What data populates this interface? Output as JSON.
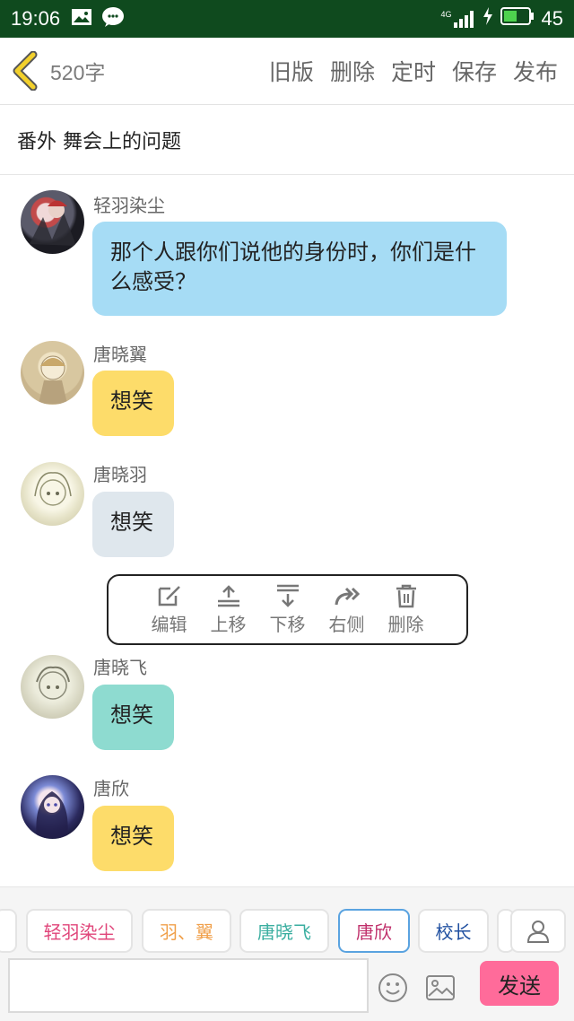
{
  "status_bar": {
    "time": "19:06",
    "network": "4G",
    "battery": "45"
  },
  "header": {
    "word_count": "520字",
    "actions": [
      "旧版",
      "删除",
      "定时",
      "保存",
      "发布"
    ]
  },
  "chapter_title": "番外  舞会上的问题",
  "messages": [
    {
      "name": "轻羽染尘",
      "text": "那个人跟你们说他的身份时，你们是什么感受？",
      "bubble_color": "#a6dcf5"
    },
    {
      "name": "唐晓翼",
      "text": "想笑",
      "bubble_color": "#fddc6a"
    },
    {
      "name": "唐晓羽",
      "text": "想笑",
      "bubble_color": "#dfe7ed"
    },
    {
      "name": "唐晓飞",
      "text": "想笑",
      "bubble_color": "#8edbd0"
    },
    {
      "name": "唐欣",
      "text": "想笑",
      "bubble_color": "#fddc6a"
    }
  ],
  "context_menu": [
    {
      "icon": "edit-icon",
      "label": "编辑"
    },
    {
      "icon": "move-up-icon",
      "label": "上移"
    },
    {
      "icon": "move-down-icon",
      "label": "下移"
    },
    {
      "icon": "right-side-icon",
      "label": "右侧"
    },
    {
      "icon": "trash-icon",
      "label": "删除"
    }
  ],
  "role_chips": [
    {
      "label": "轻羽染尘",
      "color": "#e0457a"
    },
    {
      "label": "羽、翼",
      "color": "#f0a04b"
    },
    {
      "label": "唐晓飞",
      "color": "#3aaea0"
    },
    {
      "label": "唐欣",
      "color": "#c0306b"
    },
    {
      "label": "校长",
      "color": "#1f4fa0"
    }
  ],
  "composer": {
    "input_value": "",
    "send_label": "发送"
  },
  "colors": {
    "status_bar": "#0f4a1e",
    "send_button": "#ff6b9a",
    "back_arrow": "#f2d02c"
  }
}
